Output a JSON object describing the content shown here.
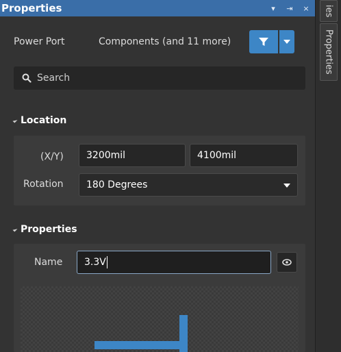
{
  "panel": {
    "title": "Properties",
    "controls": [
      "▾",
      "⇥",
      "×"
    ]
  },
  "filter": {
    "object_kind": "Power Port",
    "scope": "Components (and 11 more)"
  },
  "search": {
    "placeholder": "Search"
  },
  "location": {
    "heading": "Location",
    "xy_label": "(X/Y)",
    "x_value": "3200mil",
    "y_value": "4100mil",
    "rotation_label": "Rotation",
    "rotation_value": "180 Degrees"
  },
  "properties": {
    "heading": "Properties",
    "name_label": "Name",
    "name_value": "3.3V"
  },
  "side_tabs": {
    "tab1": "ies",
    "tab2": "Properties"
  },
  "colors": {
    "title_bar": "#3a6ea8",
    "accent": "#3d86c6",
    "panel_bg": "#333333"
  }
}
